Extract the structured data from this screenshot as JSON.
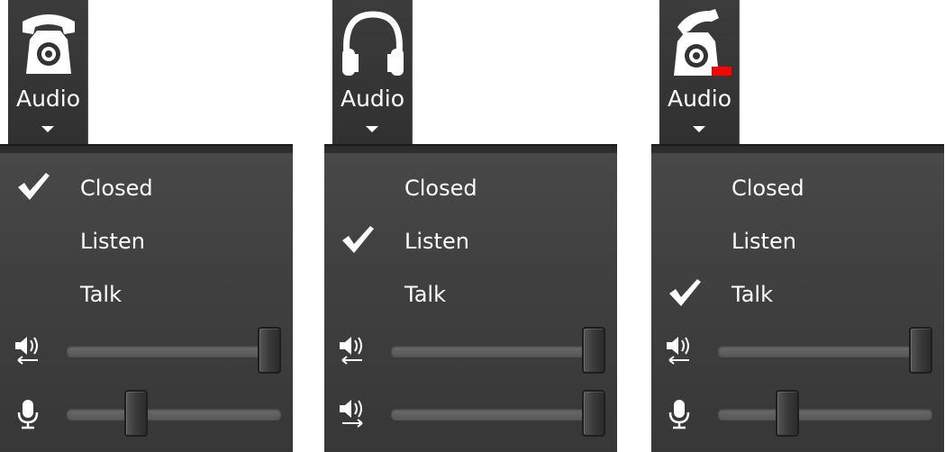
{
  "panels": [
    {
      "tab": {
        "label": "Audio",
        "icon": "telephone-icon"
      },
      "menu": {
        "items": [
          {
            "label": "Closed",
            "checked": true
          },
          {
            "label": "Listen",
            "checked": false
          },
          {
            "label": "Talk",
            "checked": false
          }
        ]
      },
      "sliders": [
        {
          "icon": "speaker-output-icon",
          "level": 1.0
        },
        {
          "icon": "microphone-icon",
          "level": 0.3
        }
      ]
    },
    {
      "tab": {
        "label": "Audio",
        "icon": "headphones-icon"
      },
      "menu": {
        "items": [
          {
            "label": "Closed",
            "checked": false
          },
          {
            "label": "Listen",
            "checked": true
          },
          {
            "label": "Talk",
            "checked": false
          }
        ]
      },
      "sliders": [
        {
          "icon": "speaker-output-icon",
          "level": 1.0
        },
        {
          "icon": "speaker-input-icon",
          "level": 1.0
        }
      ]
    },
    {
      "tab": {
        "label": "Audio",
        "icon": "telephone-offhook-icon"
      },
      "menu": {
        "items": [
          {
            "label": "Closed",
            "checked": false
          },
          {
            "label": "Listen",
            "checked": false
          },
          {
            "label": "Talk",
            "checked": true
          }
        ]
      },
      "sliders": [
        {
          "icon": "speaker-output-icon",
          "level": 1.0
        },
        {
          "icon": "microphone-icon",
          "level": 0.3
        }
      ]
    }
  ],
  "colors": {
    "menu_bg": "#404040",
    "text": "#ffffff",
    "alert": "#ff0000"
  }
}
